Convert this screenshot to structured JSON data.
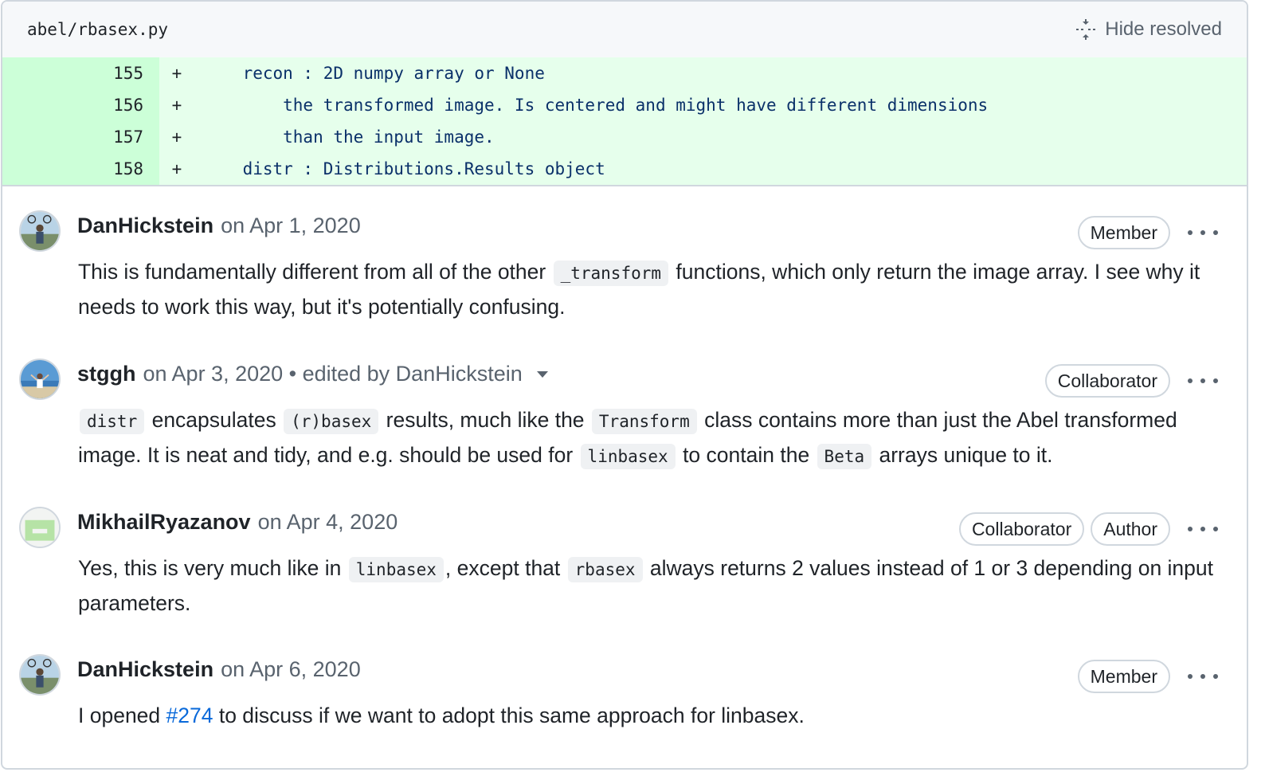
{
  "file": {
    "path": "abel/rbasex.py",
    "hide_resolved_label": "Hide resolved"
  },
  "diff": [
    {
      "num": "155",
      "sign": "+",
      "code": "    recon : 2D numpy array or None"
    },
    {
      "num": "156",
      "sign": "+",
      "code": "        the transformed image. Is centered and might have different dimensions"
    },
    {
      "num": "157",
      "sign": "+",
      "code": "        than the input image."
    },
    {
      "num": "158",
      "sign": "+",
      "code": "    distr : Distributions.Results object"
    }
  ],
  "comments": [
    {
      "author": "DanHickstein",
      "date": "on Apr 1, 2020",
      "badges": [
        "Member"
      ],
      "body": [
        {
          "t": "This is fundamentally different from all of the other "
        },
        {
          "c": "_transform"
        },
        {
          "t": " functions, which only return the image array. I see why it needs to work this way, but it's potentially confusing."
        }
      ]
    },
    {
      "author": "stggh",
      "date": "on Apr 3, 2020 • edited by DanHickstein",
      "badges": [
        "Collaborator"
      ],
      "body": [
        {
          "c": "distr"
        },
        {
          "t": " encapsulates "
        },
        {
          "c": "(r)basex"
        },
        {
          "t": " results, much like the "
        },
        {
          "c": "Transform"
        },
        {
          "t": " class contains more than just the Abel transformed image. It is neat and tidy, and e.g. should be used for "
        },
        {
          "c": "linbasex"
        },
        {
          "t": " to contain the "
        },
        {
          "c": "Beta"
        },
        {
          "t": " arrays unique to it."
        }
      ]
    },
    {
      "author": "MikhailRyazanov",
      "date": "on Apr 4, 2020",
      "badges": [
        "Collaborator",
        "Author"
      ],
      "body": [
        {
          "t": "Yes, this is very much like in "
        },
        {
          "c": "linbasex"
        },
        {
          "t": ", except that "
        },
        {
          "c": "rbasex"
        },
        {
          "t": " always returns 2 values instead of 1 or 3 depending on input parameters."
        }
      ]
    },
    {
      "author": "DanHickstein",
      "date": "on Apr 6, 2020",
      "badges": [
        "Member"
      ],
      "body": [
        {
          "t": "I opened "
        },
        {
          "l": "#274"
        },
        {
          "t": " to discuss if we want to adopt this same approach for linbasex."
        }
      ]
    }
  ],
  "colors": {
    "diff_bg": "#e6ffec",
    "diff_num_bg": "#ccffd8",
    "link": "#0969da",
    "muted": "#59636e"
  }
}
